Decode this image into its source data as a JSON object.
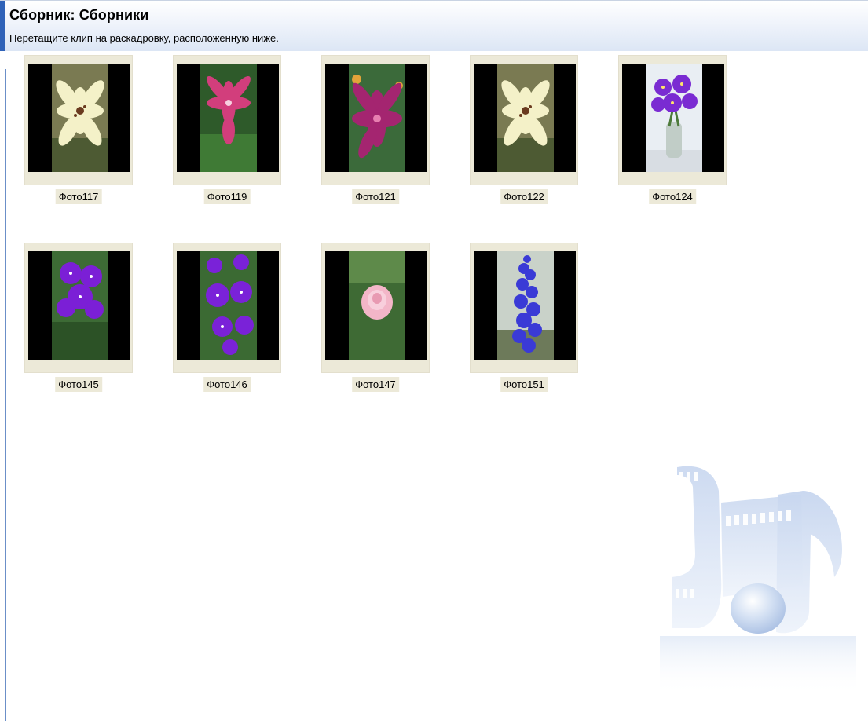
{
  "header": {
    "title": "Сборник: Сборники",
    "subtitle": "Перетащите клип на раскадровку, расположенную ниже."
  },
  "clips": [
    {
      "name": "Фото117",
      "flower": "white-lily"
    },
    {
      "name": "Фото119",
      "flower": "pink-lily"
    },
    {
      "name": "Фото121",
      "flower": "magenta-lily"
    },
    {
      "name": "Фото122",
      "flower": "white-lily"
    },
    {
      "name": "Фото124",
      "flower": "violet-vase"
    },
    {
      "name": "Фото145",
      "flower": "purple-violet"
    },
    {
      "name": "Фото146",
      "flower": "purple-violets"
    },
    {
      "name": "Фото147",
      "flower": "pink-rose"
    },
    {
      "name": "Фото151",
      "flower": "blue-delphinium"
    }
  ],
  "watermark": {
    "icon": "film-music-note-icon"
  },
  "colors": {
    "accent": "#2f62b8",
    "caption_bg": "#ece9d8",
    "header_gradient_end": "#dce6f5"
  }
}
